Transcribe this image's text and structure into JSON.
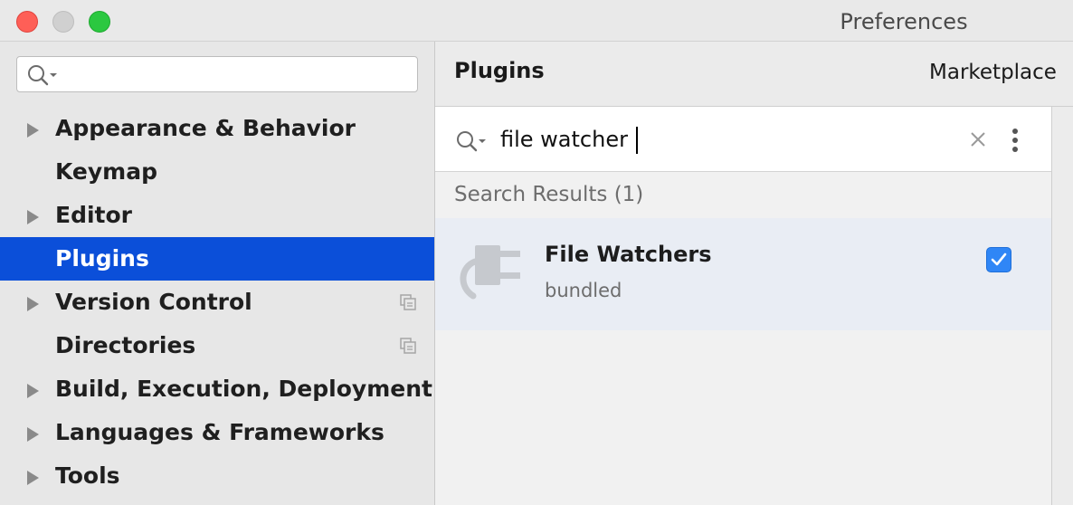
{
  "window": {
    "title": "Preferences"
  },
  "sidebar": {
    "search": {
      "value": "",
      "placeholder": ""
    },
    "items": [
      {
        "label": "Appearance & Behavior",
        "expandable": true,
        "active": false,
        "project_icon": false
      },
      {
        "label": "Keymap",
        "expandable": false,
        "active": false,
        "project_icon": false
      },
      {
        "label": "Editor",
        "expandable": true,
        "active": false,
        "project_icon": false
      },
      {
        "label": "Plugins",
        "expandable": false,
        "active": true,
        "project_icon": false
      },
      {
        "label": "Version Control",
        "expandable": true,
        "active": false,
        "project_icon": true
      },
      {
        "label": "Directories",
        "expandable": false,
        "active": false,
        "project_icon": true
      },
      {
        "label": "Build, Execution, Deployment",
        "expandable": true,
        "active": false,
        "project_icon": false
      },
      {
        "label": "Languages & Frameworks",
        "expandable": true,
        "active": false,
        "project_icon": false
      },
      {
        "label": "Tools",
        "expandable": true,
        "active": false,
        "project_icon": false
      }
    ]
  },
  "main": {
    "title": "Plugins",
    "tabs": [
      {
        "label": "Marketplace"
      }
    ],
    "search": {
      "value": "file watcher"
    },
    "results_label": "Search Results (1)",
    "results": [
      {
        "name": "File Watchers",
        "tag": "bundled",
        "enabled": true,
        "icon": "plugin-plug-icon"
      }
    ]
  },
  "icons": {
    "search": "search-icon",
    "clear": "close-icon",
    "more": "more-vertical-icon",
    "arrow": "triangle-right-icon",
    "project": "copy-icon",
    "check": "checkmark-icon"
  },
  "colors": {
    "accent": "#0b4fd9",
    "checkbox": "#2f86f6",
    "close": "#fe5f57",
    "maximize": "#2bc840",
    "minimize": "#d0d0d0"
  }
}
